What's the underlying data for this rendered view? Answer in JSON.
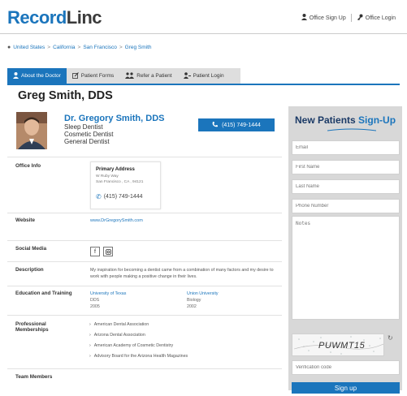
{
  "header": {
    "logo_record": "Record",
    "logo_linc": "Linc",
    "signup_link": "Office Sign Up",
    "login_link": "Office Login"
  },
  "breadcrumb": [
    "United States",
    "California",
    "San Francisco",
    "Greg Smith"
  ],
  "tabs": [
    "About the Doctor",
    "Patient Forms",
    "Refer a Patient",
    "Patient Login"
  ],
  "profile": {
    "heading": "Greg Smith, DDS",
    "name": "Dr. Gregory Smith, DDS",
    "specialties": [
      "Sleep Dentist",
      "Cosmetic Dentist",
      "General Dentist"
    ],
    "phone": "(415) 749-1444"
  },
  "sections": {
    "office_info": {
      "label": "Office Info",
      "card_title": "Primary Address",
      "address_line1": "W Ruby Way",
      "address_line2": "San Francisco , CA , 94121",
      "phone": "(415) 749-1444"
    },
    "website": {
      "label": "Website",
      "value": "www.DrGregorySmith.com"
    },
    "social": {
      "label": "Social Media",
      "icons": [
        "facebook-icon",
        "instagram-icon"
      ]
    },
    "description": {
      "label": "Description",
      "text": "My inspiration for becoming a dentist came from a combination of many factors and my desire to work with people making a positive change in their lives."
    },
    "education": {
      "label": "Education and Training",
      "entries": [
        {
          "school": "University of Texas",
          "degree": "DDS",
          "year": "2005"
        },
        {
          "school": "Union University",
          "degree": "Biology",
          "year": "2002"
        }
      ]
    },
    "memberships": {
      "label_line1": "Professional",
      "label_line2": "Memberships",
      "items": [
        "American Dental Association",
        "Arizona Dental Association",
        "American Academy of Cosmetic Dentistry",
        "Advisory Board for the Arizona Health Magazines"
      ]
    },
    "team": {
      "label": "Team Members"
    }
  },
  "sidebar": {
    "title_part1": "New Patients ",
    "title_part2": "Sign-Up",
    "placeholders": {
      "email": "Email",
      "first_name": "First Name",
      "last_name": "Last Name",
      "phone": "Phone Number",
      "notes": "Notes",
      "verification": "Verification code"
    },
    "captcha_text": "PUWMT15",
    "signup_button": "Sign up"
  },
  "colors": {
    "brand_blue": "#1b75bc",
    "sidebar_bg": "#d8d8d8",
    "title_navy": "#1b3a66"
  }
}
